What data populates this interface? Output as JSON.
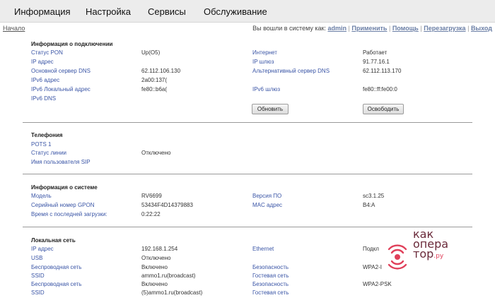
{
  "nav": {
    "tabs": [
      "Информация",
      "Настройка",
      "Сервисы",
      "Обслуживание"
    ]
  },
  "subbar": {
    "home": "Начало",
    "logged_in_prefix": "Вы вошли в систему как:",
    "user": "admin",
    "links": [
      "Применить",
      "Помощь",
      "Перезагрузка",
      "Выход"
    ]
  },
  "connection": {
    "title": "Информация о подключении",
    "pon_status_label": "Статус PON",
    "pon_status_value": "Up(O5)",
    "ip_label": "IP адрес",
    "dns_main_label": "Основной сервер DNS",
    "dns_main_value": "62.112.106.130",
    "ipv6_label": "IPv6 адрес",
    "ipv6_value": "2a00:137(",
    "ipv6_local_label": "IPv6 Локальный адрес",
    "ipv6_local_value": "fe80::b6a(",
    "ipv6_dns_label": "IPv6 DNS",
    "internet_label": "Интернет",
    "internet_value": "Работает",
    "gateway_label": "IP шлюз",
    "gateway_value": "91.77.16.1",
    "dns_alt_label": "Альтернативный сервер DNS",
    "dns_alt_value": "62.112.113.170",
    "ipv6_gateway_label": "IPv6 шлюз",
    "ipv6_gateway_value": "fe80::ff:fe00:0",
    "renew_button": "Обновить",
    "release_button": "Освободить"
  },
  "telephony": {
    "title": "Телефония",
    "pots_label": "POTS 1",
    "line_status_label": "Статус линии",
    "line_status_value": "Отключено",
    "sip_user_label": "Имя пользователя SIP"
  },
  "system": {
    "title": "Информация о системе",
    "model_label": "Модель",
    "model_value": "RV6699",
    "serial_label": "Серийный номер GPON",
    "serial_value": "53434F4D14379883",
    "uptime_label": "Время с последней загрузки:",
    "uptime_value": "0:22:22",
    "fw_label": "Версия ПО",
    "fw_value": "sc3.1.25",
    "mac_label": "MAC адрес",
    "mac_value": "B4:A"
  },
  "lan": {
    "title": "Локальная сеть",
    "ip_label": "IP адрес",
    "ip_value": "192.168.1.254",
    "usb_label": "USB",
    "usb_value": "Отключено",
    "wifi1_label": "Беспроводная сеть",
    "wifi1_value": "Включено",
    "ssid1_label": "SSID",
    "ssid1_value": "ammo1.ru(broadcast)",
    "wifi2_label": "Беспроводная сеть",
    "wifi2_value": "Включено",
    "ssid2_label": "SSID",
    "ssid2_value": "(5)ammo1.ru(broadcast)",
    "ethernet_label": "Ethernet",
    "ethernet_value": "Подкл",
    "sec1_label": "Безопасность",
    "sec1_value": "WPA2-I",
    "guest1_label": "Гостевая сеть",
    "sec2_label": "Безопасность",
    "sec2_value": "WPA2-PSK",
    "guest2_label": "Гостевая сеть"
  },
  "watermark": {
    "line1": "как",
    "line2": "опера",
    "line3": "тор",
    "suffix": ".ру"
  }
}
